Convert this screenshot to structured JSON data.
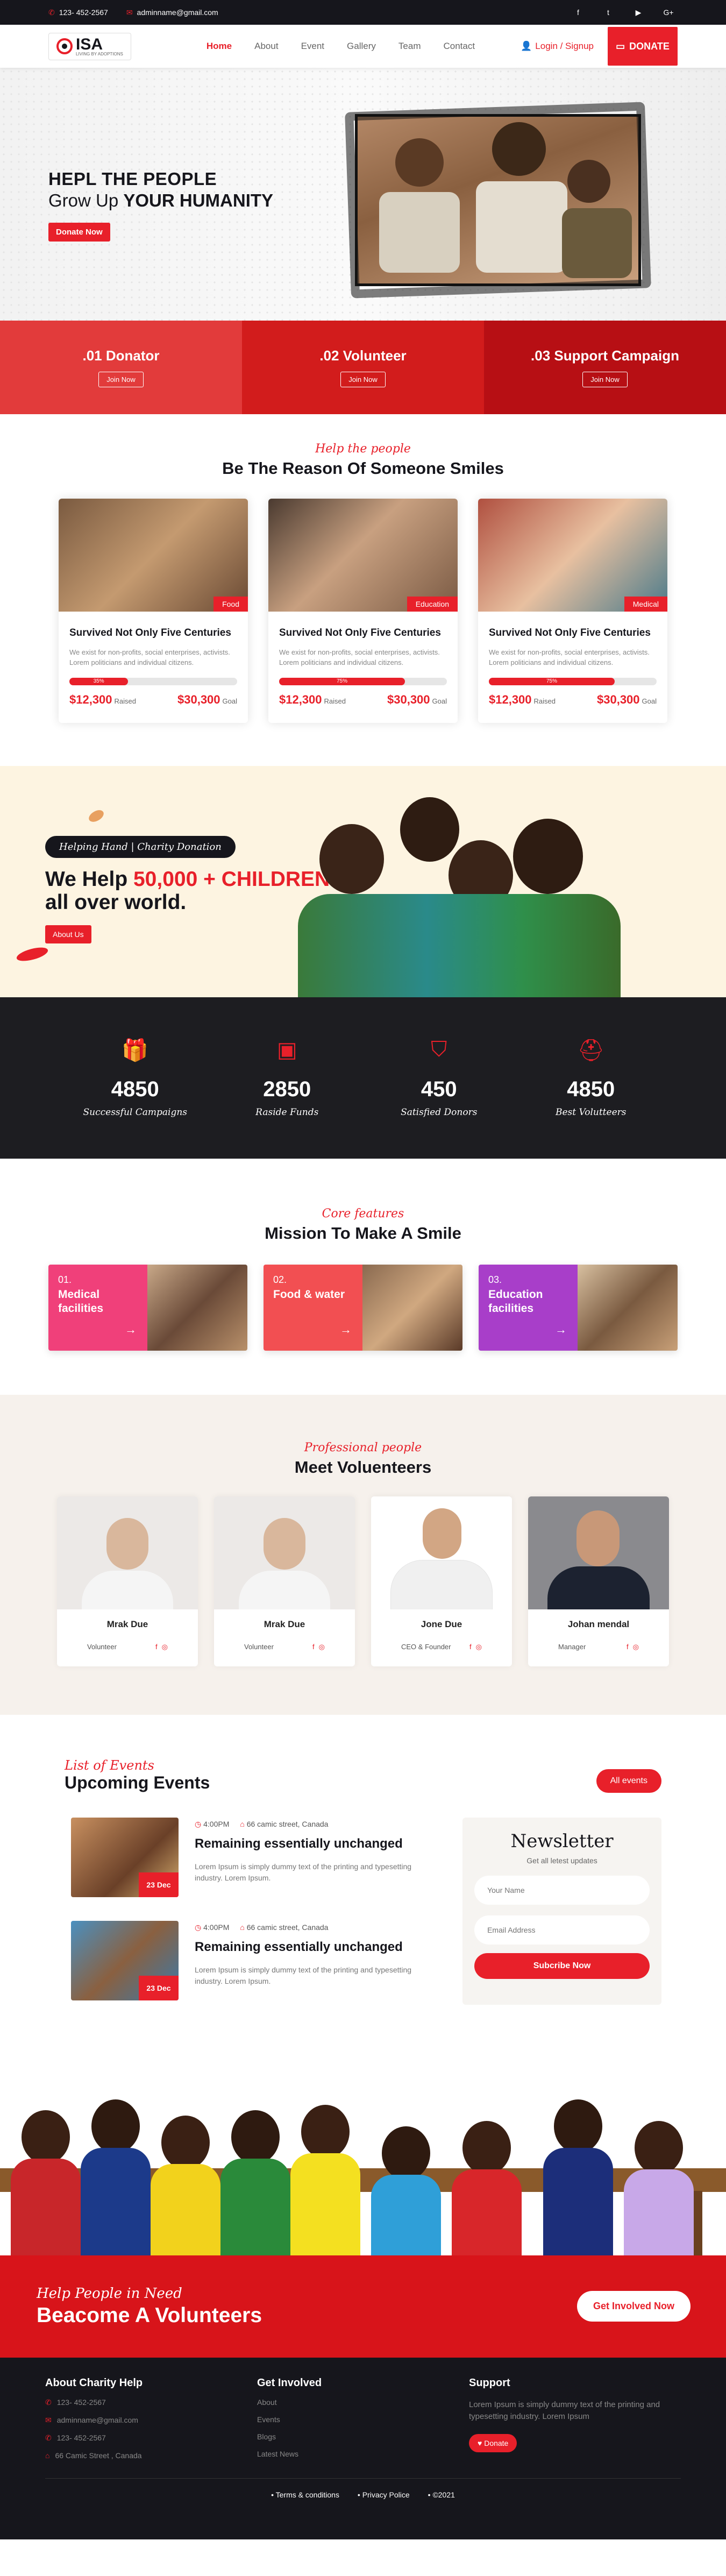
{
  "topbar": {
    "phone": "123- 452-2567",
    "email": "adminname@gmail.com",
    "social": [
      "f",
      "t",
      "▶",
      "G+"
    ]
  },
  "nav": {
    "logo_text": "ISA",
    "logo_sub": "LIVING BY ADOPTIONS",
    "items": [
      "Home",
      "About",
      "Event",
      "Gallery",
      "Team",
      "Contact"
    ],
    "login": "Login / Signup",
    "donate": "DONATE"
  },
  "hero": {
    "line1": "HEPL THE PEOPLE",
    "line2_pre": "Grow Up ",
    "line2_bold": "YOUR HUMANITY",
    "button": "Donate Now"
  },
  "cta": [
    {
      "title": ".01 Donator",
      "button": "Join Now",
      "color": "#e23b3b"
    },
    {
      "title": ".02 Volunteer",
      "button": "Join Now",
      "color": "#d21c1c"
    },
    {
      "title": ".03 Support Campaign",
      "button": "Join Now",
      "color": "#b70f14"
    }
  ],
  "causes": {
    "script": "Help the people",
    "title": "Be The Reason Of Someone Smiles",
    "cards": [
      {
        "tag": "Food",
        "title": "Survived Not Only Five Centuries",
        "text": "We exist for non-profits, social enterprises, activists. Lorem politicians and individual citizens.",
        "progress": 35,
        "progress_label": "35%",
        "raised": "$12,300",
        "raised_label": "Raised",
        "goal": "$30,300",
        "goal_label": "Goal"
      },
      {
        "tag": "Education",
        "title": "Survived Not Only Five Centuries",
        "text": "We exist for non-profits, social enterprises, activists. Lorem politicians and individual citizens.",
        "progress": 75,
        "progress_label": "75%",
        "raised": "$12,300",
        "raised_label": "Raised",
        "goal": "$30,300",
        "goal_label": "Goal"
      },
      {
        "tag": "Medical",
        "title": "Survived Not Only Five Centuries",
        "text": "We exist for non-profits, social enterprises, activists. Lorem politicians and individual citizens.",
        "progress": 75,
        "progress_label": "75%",
        "raised": "$12,300",
        "raised_label": "Raised",
        "goal": "$30,300",
        "goal_label": "Goal"
      }
    ]
  },
  "help": {
    "pill": "Helping Hand | Charity Donation",
    "h_pre": "We Help ",
    "h_red": "50,000 + CHILDREN",
    "h_post": "all over world.",
    "button": "About Us"
  },
  "stats": [
    {
      "number": "4850",
      "label": "Successful Campaigns",
      "icon": "gift-icon"
    },
    {
      "number": "2850",
      "label": "Raside Funds",
      "icon": "funds-icon"
    },
    {
      "number": "450",
      "label": "Satisfied Donors",
      "icon": "donor-icon"
    },
    {
      "number": "4850",
      "label": "Best Volutteers",
      "icon": "volunteer-icon"
    }
  ],
  "features": {
    "script": "Core features",
    "title": "Mission To Make A Smile",
    "items": [
      {
        "num": "01.",
        "title": "Medical facilities",
        "color": "#f0407a"
      },
      {
        "num": "02.",
        "title": "Food & water",
        "color": "#f24f52"
      },
      {
        "num": "03.",
        "title": "Education facilities",
        "color": "#a83ec9"
      }
    ]
  },
  "team": {
    "script": "Professional people",
    "title": "Meet Voluenteers",
    "members": [
      {
        "name": "Mrak Due",
        "role": "Volunteer"
      },
      {
        "name": "Mrak Due",
        "role": "Volunteer"
      },
      {
        "name": "Jone Due",
        "role": "CEO & Founder"
      },
      {
        "name": "Johan mendal",
        "role": "Manager"
      }
    ]
  },
  "events": {
    "script": "List of Events",
    "title": "Upcoming Events",
    "all_button": "All events",
    "items": [
      {
        "time": "4:00PM",
        "place": "66 camic street, Canada",
        "title": "Remaining essentially unchanged",
        "text": "Lorem Ipsum is simply dummy text of the printing and typesetting industry. Lorem Ipsum.",
        "date": "23 Dec"
      },
      {
        "time": "4:00PM",
        "place": "66 camic street, Canada",
        "title": "Remaining essentially unchanged",
        "text": "Lorem Ipsum is simply dummy text of the printing and typesetting industry. Lorem Ipsum.",
        "date": "23 Dec"
      }
    ]
  },
  "newsletter": {
    "title": "Newsletter",
    "subtitle": "Get all letest updates",
    "name_placeholder": "Your Name",
    "email_placeholder": "Email Address",
    "button": "Subcribe Now"
  },
  "volunteer_cta": {
    "script": "Help People in Need",
    "title": "Beacome A Volunteers",
    "button": "Get Involved Now"
  },
  "footer": {
    "col1_title": "About Charity Help",
    "col1_items": [
      "123- 452-2567",
      "adminname@gmail.com",
      "123- 452-2567",
      "66 Camic Street , Canada"
    ],
    "col2_title": "Get Involved",
    "col2_items": [
      "About",
      "Events",
      "Blogs",
      "Latest News"
    ],
    "col3_title": "Support",
    "col3_text": "Lorem Ipsum is simply dummy text of the printing and typesetting industry. Lorem Ipsum",
    "col3_button": "Donate",
    "bottom": [
      "Terms & conditions",
      "Privacy Police",
      "©2021"
    ]
  }
}
